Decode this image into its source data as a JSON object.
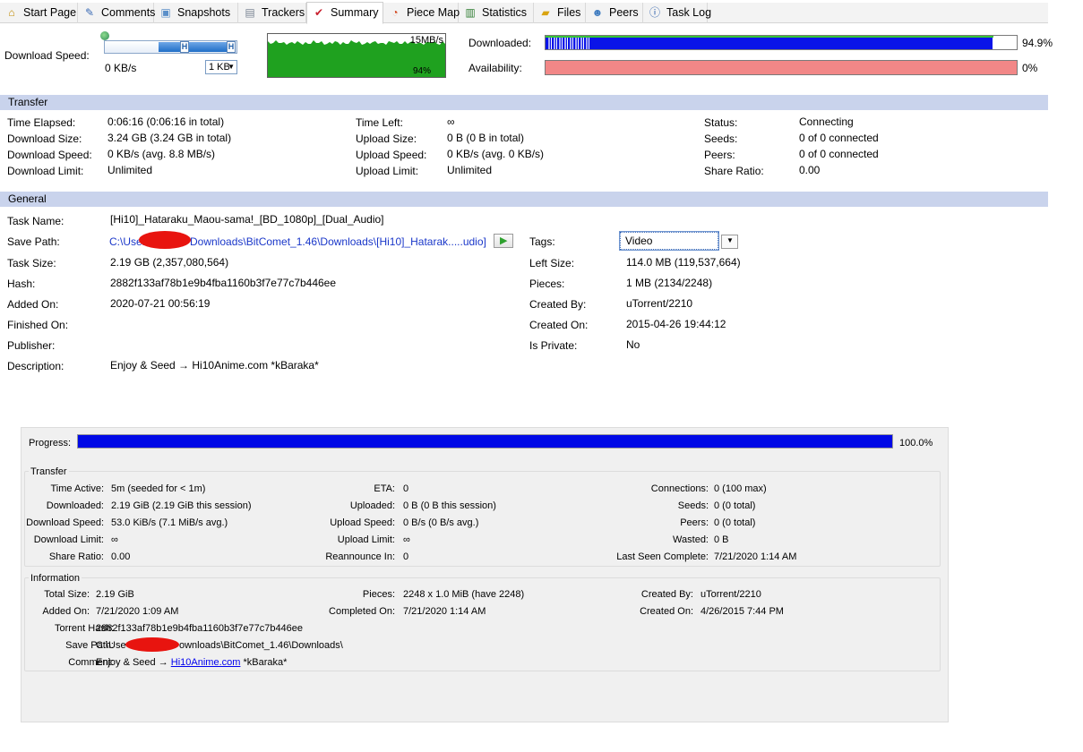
{
  "tabs": [
    {
      "label": "Start Page",
      "icon": "start-page-icon",
      "glyph": "⌂",
      "color": "#c08a00"
    },
    {
      "label": "Comments",
      "icon": "comments-icon",
      "glyph": "✎",
      "color": "#3b6bb5"
    },
    {
      "label": "Snapshots",
      "icon": "snapshots-icon",
      "glyph": "▣",
      "color": "#5a8fc9"
    },
    {
      "label": "Trackers",
      "icon": "trackers-icon",
      "glyph": "▤",
      "color": "#7b8594"
    },
    {
      "label": "Summary",
      "icon": "summary-icon",
      "glyph": "✔",
      "color": "#c8202e"
    },
    {
      "label": "Piece Map",
      "icon": "piece-map-icon",
      "glyph": "◔",
      "color": "#d2461e"
    },
    {
      "label": "Statistics",
      "icon": "statistics-icon",
      "glyph": "▥",
      "color": "#2f7d32"
    },
    {
      "label": "Files",
      "icon": "files-icon",
      "glyph": "▰",
      "color": "#d9a411"
    },
    {
      "label": "Peers",
      "icon": "peers-icon",
      "glyph": "☻",
      "color": "#3f7cc0"
    },
    {
      "label": "Task Log",
      "icon": "task-log-icon",
      "glyph": "ⓘ",
      "color": "#2357a8"
    }
  ],
  "speed": {
    "label": "Download Speed:",
    "current": "0 KB/s",
    "limit_select": "1 KB",
    "graph_max": "15MB/s",
    "graph_pct": "94%",
    "graph_color": "#1fa11f"
  },
  "bars": {
    "downloaded_label": "Downloaded:",
    "downloaded_pct": "94.9%",
    "downloaded_fraction": 0.949,
    "availability_label": "Availability:",
    "availability_pct": "0%",
    "availability_fraction": 0,
    "downloaded_color": "#0a14e8",
    "availability_color": "#f28787"
  },
  "transfer": {
    "title": "Transfer",
    "col1": [
      {
        "label": "Time Elapsed:",
        "value": "0:06:16 (0:06:16 in total)"
      },
      {
        "label": "Download Size:",
        "value": "3.24 GB (3.24 GB in total)"
      },
      {
        "label": "Download Speed:",
        "value": "0 KB/s (avg. 8.8 MB/s)"
      },
      {
        "label": "Download Limit:",
        "value": "Unlimited"
      }
    ],
    "col2": [
      {
        "label": "Time Left:",
        "value": "∞"
      },
      {
        "label": "Upload Size:",
        "value": "0 B (0 B in total)"
      },
      {
        "label": "Upload Speed:",
        "value": "0 KB/s (avg. 0 KB/s)"
      },
      {
        "label": "Upload Limit:",
        "value": "Unlimited"
      }
    ],
    "col3": [
      {
        "label": "Status:",
        "value": "Connecting"
      },
      {
        "label": "Seeds:",
        "value": "0 of 0 connected"
      },
      {
        "label": "Peers:",
        "value": "0 of 0 connected"
      },
      {
        "label": "Share Ratio:",
        "value": "0.00"
      }
    ]
  },
  "general": {
    "title": "General",
    "task_name_label": "Task Name:",
    "task_name": "[Hi10]_Hataraku_Maou-sama!_[BD_1080p]_[Dual_Audio]",
    "save_path_label": "Save Path:",
    "save_path_start": "C:\\User",
    "save_path_end": "Downloads\\BitComet_1.46\\Downloads\\[Hi10]_Hatarak.....udio]",
    "left": [
      {
        "label": "Task Size:",
        "value": "2.19 GB (2,357,080,564)"
      },
      {
        "label": "Hash:",
        "value": "2882f133af78b1e9b4fba1160b3f7e77c7b446ee"
      },
      {
        "label": "Added On:",
        "value": "2020-07-21 00:56:19"
      },
      {
        "label": "Finished On:",
        "value": ""
      },
      {
        "label": "Publisher:",
        "value": ""
      },
      {
        "label": "Description:",
        "value": "Enjoy & Seed → Hi10Anime.com *kBaraka*"
      }
    ],
    "tags_label": "Tags:",
    "tags_value": "Video",
    "right": [
      {
        "label": "Left Size:",
        "value": "114.0 MB (119,537,664)"
      },
      {
        "label": "Pieces:",
        "value": "1 MB (2134/2248)"
      },
      {
        "label": "Created By:",
        "value": "uTorrent/2210"
      },
      {
        "label": "Created On:",
        "value": "2015-04-26 19:44:12"
      },
      {
        "label": "Is Private:",
        "value": "No"
      }
    ]
  },
  "qb": {
    "progress_label": "Progress:",
    "progress_pct": "100.0%",
    "progress_fraction": 1.0,
    "progress_color": "#0009e6",
    "transfer_title": "Transfer",
    "t1": [
      {
        "label": "Time Active:",
        "value": "5m (seeded for < 1m)"
      },
      {
        "label": "Downloaded:",
        "value": "2.19 GiB (2.19 GiB this session)"
      },
      {
        "label": "Download Speed:",
        "value": "53.0 KiB/s (7.1 MiB/s avg.)"
      },
      {
        "label": "Download Limit:",
        "value": "∞"
      },
      {
        "label": "Share Ratio:",
        "value": "0.00"
      }
    ],
    "t2": [
      {
        "label": "ETA:",
        "value": "0"
      },
      {
        "label": "Uploaded:",
        "value": "0 B (0 B this session)"
      },
      {
        "label": "Upload Speed:",
        "value": "0 B/s (0 B/s avg.)"
      },
      {
        "label": "Upload Limit:",
        "value": "∞"
      },
      {
        "label": "Reannounce In:",
        "value": "0"
      }
    ],
    "t3": [
      {
        "label": "Connections:",
        "value": "0 (100 max)"
      },
      {
        "label": "Seeds:",
        "value": "0 (0 total)"
      },
      {
        "label": "Peers:",
        "value": "0 (0 total)"
      },
      {
        "label": "Wasted:",
        "value": "0 B"
      },
      {
        "label": "Last Seen Complete:",
        "value": "7/21/2020 1:14 AM"
      }
    ],
    "info_title": "Information",
    "i1": [
      {
        "label": "Total Size:",
        "value": "2.19 GiB"
      },
      {
        "label": "Added On:",
        "value": "7/21/2020 1:09 AM"
      }
    ],
    "i2": [
      {
        "label": "Pieces:",
        "value": "2248 x 1.0 MiB (have 2248)"
      },
      {
        "label": "Completed On:",
        "value": "7/21/2020 1:14 AM"
      }
    ],
    "i3": [
      {
        "label": "Created By:",
        "value": "uTorrent/2210"
      },
      {
        "label": "Created On:",
        "value": "4/26/2015 7:44 PM"
      }
    ],
    "hash_label": "Torrent Hash:",
    "hash": "2882f133af78b1e9b4fba1160b3f7e77c7b446ee",
    "save_label": "Save Path:",
    "save_start": "C:\\Use",
    "save_end": "ownloads\\BitComet_1.46\\Downloads\\",
    "comment_label": "Comment:",
    "comment_pre": "Enjoy & Seed → ",
    "comment_link": "Hi10Anime.com",
    "comment_post": " *kBaraka*"
  }
}
